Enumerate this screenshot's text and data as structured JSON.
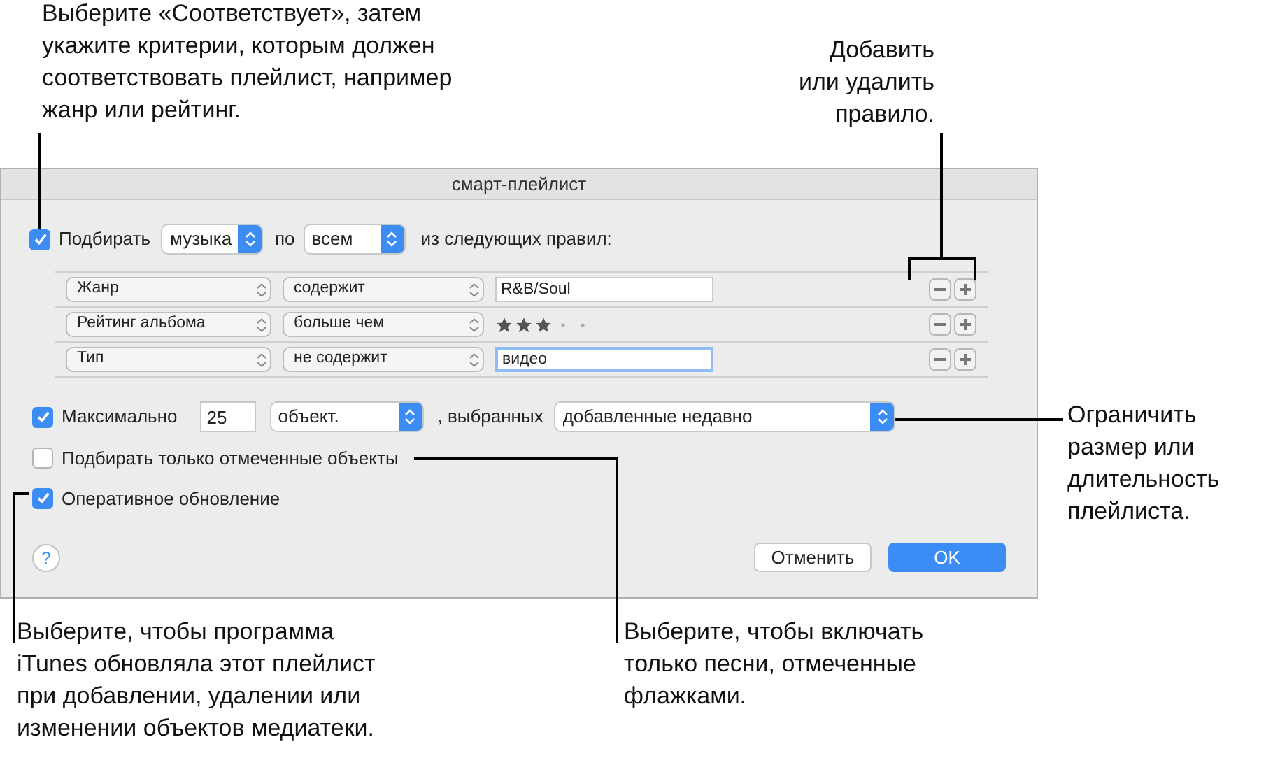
{
  "callouts": {
    "top_left": "Выберите «Соответствует», затем\nукажите критерии, которым должен\nсоответствовать плейлист, например\nжанр или рейтинг.",
    "top_right": "Добавить\nили удалить\nправило.",
    "right": "Ограничить\nразмер или\nдлительность\nплейлиста.",
    "bottom_left": "Выберите, чтобы программа\niTunes обновляла этот плейлист\nпри добавлении, удалении или\nизменении объектов медиатеки.",
    "bottom_right": "Выберите, чтобы включать\nтолько песни, отмеченные\nфлажками."
  },
  "window": {
    "title": "смарт-плейлист"
  },
  "match": {
    "checked": true,
    "label": "Подбирать",
    "media": "музыка",
    "by": "по",
    "scope": "всем",
    "suffix": "из следующих правил:"
  },
  "rules": [
    {
      "field": "Жанр",
      "operator": "содержит",
      "kind": "text",
      "value": "R&B/Soul",
      "focused": false
    },
    {
      "field": "Рейтинг альбома",
      "operator": "больше чем",
      "kind": "rating",
      "stars": 3
    },
    {
      "field": "Тип",
      "operator": "не содержит",
      "kind": "text",
      "value": "видео",
      "focused": true
    }
  ],
  "limit": {
    "checked": true,
    "label": "Максимально",
    "count": "25",
    "unit": "объект.",
    "selected_by": ", выбранных",
    "order": "добавленные недавно"
  },
  "options": [
    {
      "label": "Подбирать только отмеченные объекты",
      "checked": false
    },
    {
      "label": "Оперативное обновление",
      "checked": true
    }
  ],
  "help": "?",
  "buttons": {
    "cancel": "Отменить",
    "ok": "OK"
  }
}
